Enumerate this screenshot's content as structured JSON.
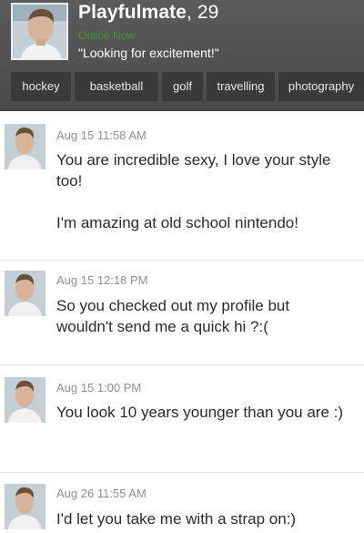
{
  "profile": {
    "name": "Playfulmate",
    "age_suffix": ", 29",
    "status": "Online Now",
    "quote": "\"Looking for excitement!\"",
    "status_color": "#3c9b25"
  },
  "tags": [
    "hockey",
    "basketball",
    "golf",
    "travelling",
    "photography"
  ],
  "messages": [
    {
      "time": "Aug 15 11:58 AM",
      "text": "You are incredible sexy, I love your style too!\n\nI'm amazing at old school nintendo!"
    },
    {
      "time": "Aug 15 12:18 PM",
      "text": "So you checked out my profile but wouldn't send me a quick hi ?:("
    },
    {
      "time": "Aug 15 1:00 PM",
      "text": "You look 10 years younger than you are :)"
    },
    {
      "time": "Aug 26 11:55 AM",
      "text": "I'd let you take me with a strap on:)"
    }
  ]
}
